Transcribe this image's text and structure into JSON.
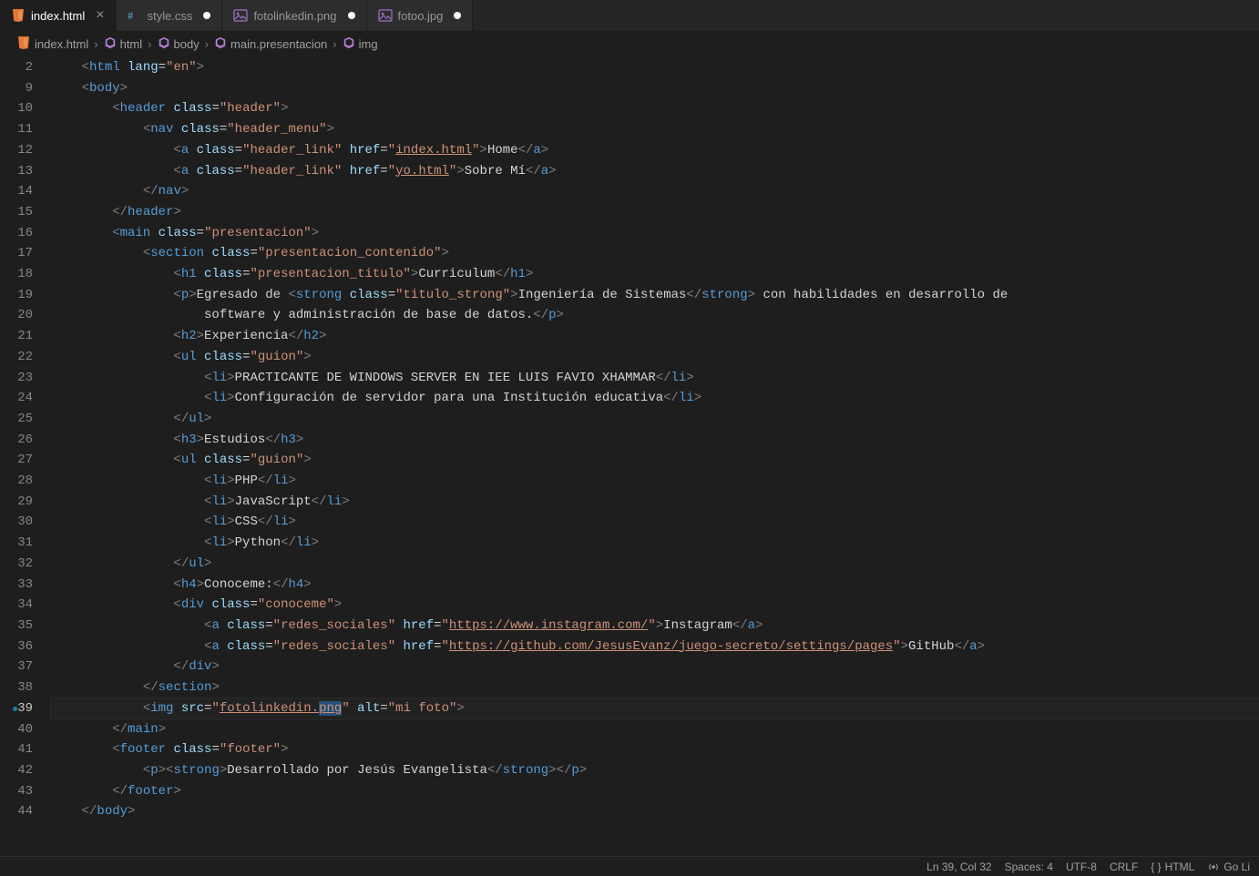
{
  "tabs": [
    {
      "label": "index.html",
      "icon": "html",
      "active": true,
      "close": true
    },
    {
      "label": "style.css",
      "icon": "css",
      "active": false,
      "dirty": true
    },
    {
      "label": "fotolinkedin.png",
      "icon": "image",
      "active": false,
      "dirty": true
    },
    {
      "label": "fotoo.jpg",
      "icon": "image",
      "active": false,
      "dirty": true
    }
  ],
  "breadcrumbs": [
    {
      "icon": "html",
      "label": "index.html"
    },
    {
      "icon": "cube",
      "label": "html"
    },
    {
      "icon": "cube",
      "label": "body"
    },
    {
      "icon": "cube",
      "label": "main.presentacion"
    },
    {
      "icon": "cube",
      "label": "img"
    }
  ],
  "line_numbers": [
    "2",
    "9",
    "10",
    "11",
    "12",
    "13",
    "14",
    "15",
    "16",
    "17",
    "18",
    "19",
    "20",
    "21",
    "22",
    "23",
    "24",
    "25",
    "26",
    "27",
    "28",
    "29",
    "30",
    "31",
    "32",
    "33",
    "34",
    "35",
    "36",
    "37",
    "38",
    "39",
    "40",
    "41",
    "42",
    "43",
    "44"
  ],
  "active_line_index": 31,
  "code": [
    [
      [
        "    ",
        ""
      ],
      [
        "<",
        "p"
      ],
      [
        "html",
        "t"
      ],
      [
        " ",
        ""
      ],
      [
        "lang",
        "a"
      ],
      [
        "=",
        "e"
      ],
      [
        "\"en\"",
        "s"
      ],
      [
        ">",
        "p"
      ]
    ],
    [
      [
        "    ",
        ""
      ],
      [
        "<",
        "p"
      ],
      [
        "body",
        "t"
      ],
      [
        ">",
        "p"
      ]
    ],
    [
      [
        "        ",
        ""
      ],
      [
        "<",
        "p"
      ],
      [
        "header",
        "t"
      ],
      [
        " ",
        ""
      ],
      [
        "class",
        "a"
      ],
      [
        "=",
        "e"
      ],
      [
        "\"header\"",
        "s"
      ],
      [
        ">",
        "p"
      ]
    ],
    [
      [
        "            ",
        ""
      ],
      [
        "<",
        "p"
      ],
      [
        "nav",
        "t"
      ],
      [
        " ",
        ""
      ],
      [
        "class",
        "a"
      ],
      [
        "=",
        "e"
      ],
      [
        "\"header_menu\"",
        "s"
      ],
      [
        ">",
        "p"
      ]
    ],
    [
      [
        "                ",
        ""
      ],
      [
        "<",
        "p"
      ],
      [
        "a",
        "t"
      ],
      [
        " ",
        ""
      ],
      [
        "class",
        "a"
      ],
      [
        "=",
        "e"
      ],
      [
        "\"header_link\"",
        "s"
      ],
      [
        " ",
        ""
      ],
      [
        "href",
        "a"
      ],
      [
        "=",
        "e"
      ],
      [
        "\"",
        "s"
      ],
      [
        "index.html",
        "sl"
      ],
      [
        "\"",
        "s"
      ],
      [
        ">",
        "p"
      ],
      [
        "Home",
        "x"
      ],
      [
        "</",
        "p"
      ],
      [
        "a",
        "t"
      ],
      [
        ">",
        "p"
      ]
    ],
    [
      [
        "                ",
        ""
      ],
      [
        "<",
        "p"
      ],
      [
        "a",
        "t"
      ],
      [
        " ",
        ""
      ],
      [
        "class",
        "a"
      ],
      [
        "=",
        "e"
      ],
      [
        "\"header_link\"",
        "s"
      ],
      [
        " ",
        ""
      ],
      [
        "href",
        "a"
      ],
      [
        "=",
        "e"
      ],
      [
        "\"",
        "s"
      ],
      [
        "yo.html",
        "sl"
      ],
      [
        "\"",
        "s"
      ],
      [
        ">",
        "p"
      ],
      [
        "Sobre Mí",
        "x"
      ],
      [
        "</",
        "p"
      ],
      [
        "a",
        "t"
      ],
      [
        ">",
        "p"
      ]
    ],
    [
      [
        "            ",
        ""
      ],
      [
        "</",
        "p"
      ],
      [
        "nav",
        "t"
      ],
      [
        ">",
        "p"
      ]
    ],
    [
      [
        "        ",
        ""
      ],
      [
        "</",
        "p"
      ],
      [
        "header",
        "t"
      ],
      [
        ">",
        "p"
      ]
    ],
    [
      [
        "        ",
        ""
      ],
      [
        "<",
        "p"
      ],
      [
        "main",
        "t"
      ],
      [
        " ",
        ""
      ],
      [
        "class",
        "a"
      ],
      [
        "=",
        "e"
      ],
      [
        "\"presentacion\"",
        "s"
      ],
      [
        ">",
        "p"
      ]
    ],
    [
      [
        "            ",
        ""
      ],
      [
        "<",
        "p"
      ],
      [
        "section",
        "t"
      ],
      [
        " ",
        ""
      ],
      [
        "class",
        "a"
      ],
      [
        "=",
        "e"
      ],
      [
        "\"presentacion_contenido\"",
        "s"
      ],
      [
        ">",
        "p"
      ]
    ],
    [
      [
        "                ",
        ""
      ],
      [
        "<",
        "p"
      ],
      [
        "h1",
        "t"
      ],
      [
        " ",
        ""
      ],
      [
        "class",
        "a"
      ],
      [
        "=",
        "e"
      ],
      [
        "\"presentacion_titulo\"",
        "s"
      ],
      [
        ">",
        "p"
      ],
      [
        "Curriculum",
        "x"
      ],
      [
        "</",
        "p"
      ],
      [
        "h1",
        "t"
      ],
      [
        ">",
        "p"
      ]
    ],
    [
      [
        "                ",
        ""
      ],
      [
        "<",
        "p"
      ],
      [
        "p",
        "t"
      ],
      [
        ">",
        "p"
      ],
      [
        "Egresado de ",
        "x"
      ],
      [
        "<",
        "p"
      ],
      [
        "strong",
        "t"
      ],
      [
        " ",
        ""
      ],
      [
        "class",
        "a"
      ],
      [
        "=",
        "e"
      ],
      [
        "\"titulo_strong\"",
        "s"
      ],
      [
        ">",
        "p"
      ],
      [
        "Ingeniería de Sistemas",
        "x"
      ],
      [
        "</",
        "p"
      ],
      [
        "strong",
        "t"
      ],
      [
        ">",
        "p"
      ],
      [
        " con habilidades en desarrollo de",
        "x"
      ]
    ],
    [
      [
        "                    ",
        ""
      ],
      [
        "software y administración de base de datos.",
        "x"
      ],
      [
        "</",
        "p"
      ],
      [
        "p",
        "t"
      ],
      [
        ">",
        "p"
      ]
    ],
    [
      [
        "                ",
        ""
      ],
      [
        "<",
        "p"
      ],
      [
        "h2",
        "t"
      ],
      [
        ">",
        "p"
      ],
      [
        "Experiencia",
        "x"
      ],
      [
        "</",
        "p"
      ],
      [
        "h2",
        "t"
      ],
      [
        ">",
        "p"
      ]
    ],
    [
      [
        "                ",
        ""
      ],
      [
        "<",
        "p"
      ],
      [
        "ul",
        "t"
      ],
      [
        " ",
        ""
      ],
      [
        "class",
        "a"
      ],
      [
        "=",
        "e"
      ],
      [
        "\"guion\"",
        "s"
      ],
      [
        ">",
        "p"
      ]
    ],
    [
      [
        "                    ",
        ""
      ],
      [
        "<",
        "p"
      ],
      [
        "li",
        "t"
      ],
      [
        ">",
        "p"
      ],
      [
        "PRACTICANTE DE WINDOWS SERVER EN IEE LUIS FAVIO XHAMMAR",
        "x"
      ],
      [
        "</",
        "p"
      ],
      [
        "li",
        "t"
      ],
      [
        ">",
        "p"
      ]
    ],
    [
      [
        "                    ",
        ""
      ],
      [
        "<",
        "p"
      ],
      [
        "li",
        "t"
      ],
      [
        ">",
        "p"
      ],
      [
        "Configuración de servidor para una Institución educativa",
        "x"
      ],
      [
        "</",
        "p"
      ],
      [
        "li",
        "t"
      ],
      [
        ">",
        "p"
      ]
    ],
    [
      [
        "                ",
        ""
      ],
      [
        "</",
        "p"
      ],
      [
        "ul",
        "t"
      ],
      [
        ">",
        "p"
      ]
    ],
    [
      [
        "                ",
        ""
      ],
      [
        "<",
        "p"
      ],
      [
        "h3",
        "t"
      ],
      [
        ">",
        "p"
      ],
      [
        "Estudios",
        "x"
      ],
      [
        "</",
        "p"
      ],
      [
        "h3",
        "t"
      ],
      [
        ">",
        "p"
      ]
    ],
    [
      [
        "                ",
        ""
      ],
      [
        "<",
        "p"
      ],
      [
        "ul",
        "t"
      ],
      [
        " ",
        ""
      ],
      [
        "class",
        "a"
      ],
      [
        "=",
        "e"
      ],
      [
        "\"guion\"",
        "s"
      ],
      [
        ">",
        "p"
      ]
    ],
    [
      [
        "                    ",
        ""
      ],
      [
        "<",
        "p"
      ],
      [
        "li",
        "t"
      ],
      [
        ">",
        "p"
      ],
      [
        "PHP",
        "x"
      ],
      [
        "</",
        "p"
      ],
      [
        "li",
        "t"
      ],
      [
        ">",
        "p"
      ]
    ],
    [
      [
        "                    ",
        ""
      ],
      [
        "<",
        "p"
      ],
      [
        "li",
        "t"
      ],
      [
        ">",
        "p"
      ],
      [
        "JavaScript",
        "x"
      ],
      [
        "</",
        "p"
      ],
      [
        "li",
        "t"
      ],
      [
        ">",
        "p"
      ]
    ],
    [
      [
        "                    ",
        ""
      ],
      [
        "<",
        "p"
      ],
      [
        "li",
        "t"
      ],
      [
        ">",
        "p"
      ],
      [
        "CSS",
        "x"
      ],
      [
        "</",
        "p"
      ],
      [
        "li",
        "t"
      ],
      [
        ">",
        "p"
      ]
    ],
    [
      [
        "                    ",
        ""
      ],
      [
        "<",
        "p"
      ],
      [
        "li",
        "t"
      ],
      [
        ">",
        "p"
      ],
      [
        "Python",
        "x"
      ],
      [
        "</",
        "p"
      ],
      [
        "li",
        "t"
      ],
      [
        ">",
        "p"
      ]
    ],
    [
      [
        "                ",
        ""
      ],
      [
        "</",
        "p"
      ],
      [
        "ul",
        "t"
      ],
      [
        ">",
        "p"
      ]
    ],
    [
      [
        "                ",
        ""
      ],
      [
        "<",
        "p"
      ],
      [
        "h4",
        "t"
      ],
      [
        ">",
        "p"
      ],
      [
        "Conoceme:",
        "x"
      ],
      [
        "</",
        "p"
      ],
      [
        "h4",
        "t"
      ],
      [
        ">",
        "p"
      ]
    ],
    [
      [
        "                ",
        ""
      ],
      [
        "<",
        "p"
      ],
      [
        "div",
        "t"
      ],
      [
        " ",
        ""
      ],
      [
        "class",
        "a"
      ],
      [
        "=",
        "e"
      ],
      [
        "\"conoceme\"",
        "s"
      ],
      [
        ">",
        "p"
      ]
    ],
    [
      [
        "                    ",
        ""
      ],
      [
        "<",
        "p"
      ],
      [
        "a",
        "t"
      ],
      [
        " ",
        ""
      ],
      [
        "class",
        "a"
      ],
      [
        "=",
        "e"
      ],
      [
        "\"redes_sociales\"",
        "s"
      ],
      [
        " ",
        ""
      ],
      [
        "href",
        "a"
      ],
      [
        "=",
        "e"
      ],
      [
        "\"",
        "s"
      ],
      [
        "https://www.instagram.com/",
        "sl"
      ],
      [
        "\"",
        "s"
      ],
      [
        ">",
        "p"
      ],
      [
        "Instagram",
        "x"
      ],
      [
        "</",
        "p"
      ],
      [
        "a",
        "t"
      ],
      [
        ">",
        "p"
      ]
    ],
    [
      [
        "                    ",
        ""
      ],
      [
        "<",
        "p"
      ],
      [
        "a",
        "t"
      ],
      [
        " ",
        ""
      ],
      [
        "class",
        "a"
      ],
      [
        "=",
        "e"
      ],
      [
        "\"redes_sociales\"",
        "s"
      ],
      [
        " ",
        ""
      ],
      [
        "href",
        "a"
      ],
      [
        "=",
        "e"
      ],
      [
        "\"",
        "s"
      ],
      [
        "https://github.com/JesusEvanz/juego-secreto/settings/pages",
        "sl"
      ],
      [
        "\"",
        "s"
      ],
      [
        ">",
        "p"
      ],
      [
        "GitHub",
        "x"
      ],
      [
        "</",
        "p"
      ],
      [
        "a",
        "t"
      ],
      [
        ">",
        "p"
      ]
    ],
    [
      [
        "                ",
        ""
      ],
      [
        "</",
        "p"
      ],
      [
        "div",
        "t"
      ],
      [
        ">",
        "p"
      ]
    ],
    [
      [
        "            ",
        ""
      ],
      [
        "</",
        "p"
      ],
      [
        "section",
        "t"
      ],
      [
        ">",
        "p"
      ]
    ],
    [
      [
        "            ",
        ""
      ],
      [
        "<",
        "p"
      ],
      [
        "img",
        "t"
      ],
      [
        " ",
        ""
      ],
      [
        "src",
        "a"
      ],
      [
        "=",
        "e"
      ],
      [
        "\"",
        "s"
      ],
      [
        "fotolinkedin.",
        "sl"
      ],
      [
        "png",
        "slsel"
      ],
      [
        "\"",
        "s"
      ],
      [
        " ",
        ""
      ],
      [
        "alt",
        "a"
      ],
      [
        "=",
        "e"
      ],
      [
        "\"mi foto\"",
        "s"
      ],
      [
        ">",
        "p"
      ]
    ],
    [
      [
        "        ",
        ""
      ],
      [
        "</",
        "p"
      ],
      [
        "main",
        "t"
      ],
      [
        ">",
        "p"
      ]
    ],
    [
      [
        "        ",
        ""
      ],
      [
        "<",
        "p"
      ],
      [
        "footer",
        "t"
      ],
      [
        " ",
        ""
      ],
      [
        "class",
        "a"
      ],
      [
        "=",
        "e"
      ],
      [
        "\"footer\"",
        "s"
      ],
      [
        ">",
        "p"
      ]
    ],
    [
      [
        "            ",
        ""
      ],
      [
        "<",
        "p"
      ],
      [
        "p",
        "t"
      ],
      [
        ">",
        "p"
      ],
      [
        "<",
        "p"
      ],
      [
        "strong",
        "t"
      ],
      [
        ">",
        "p"
      ],
      [
        "Desarrollado por Jesús Evangelista",
        "x"
      ],
      [
        "</",
        "p"
      ],
      [
        "strong",
        "t"
      ],
      [
        ">",
        "p"
      ],
      [
        "</",
        "p"
      ],
      [
        "p",
        "t"
      ],
      [
        ">",
        "p"
      ]
    ],
    [
      [
        "        ",
        ""
      ],
      [
        "</",
        "p"
      ],
      [
        "footer",
        "t"
      ],
      [
        ">",
        "p"
      ]
    ],
    [
      [
        "    ",
        ""
      ],
      [
        "</",
        "p"
      ],
      [
        "body",
        "t"
      ],
      [
        ">",
        "p"
      ]
    ]
  ],
  "status": {
    "cursor": "Ln 39, Col 32",
    "spaces": "Spaces: 4",
    "encoding": "UTF-8",
    "eol": "CRLF",
    "lang": "HTML",
    "golive": "Go Li"
  }
}
